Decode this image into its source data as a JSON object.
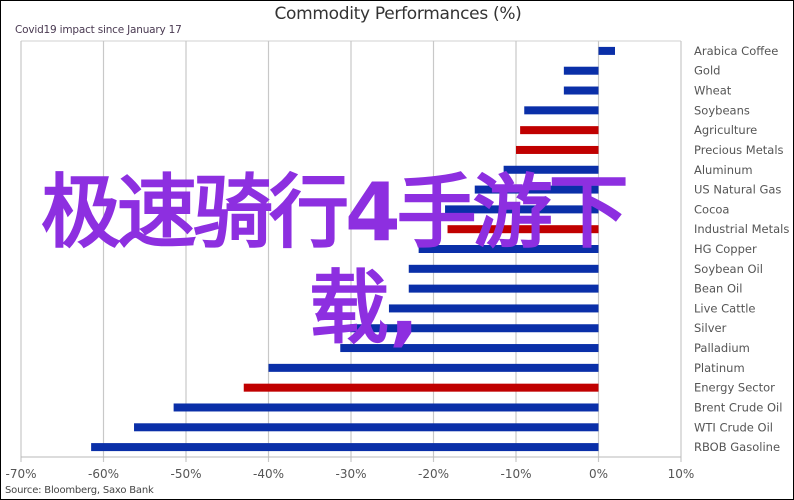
{
  "chart_data": {
    "type": "bar",
    "orientation": "horizontal",
    "title": "Commodity Performances (%)",
    "subtitle": "Covid19 impact since January 17",
    "source": "Source: Bloomberg, Saxo Bank",
    "xlabel": "",
    "ylabel": "",
    "xlim": [
      -70,
      10
    ],
    "x_ticks": [
      -70,
      -60,
      -50,
      -40,
      -30,
      -20,
      -10,
      0,
      10
    ],
    "x_tick_labels": [
      "-70%",
      "-60%",
      "-50%",
      "-40%",
      "-30%",
      "-20%",
      "-10%",
      "0%",
      "10%"
    ],
    "grid": "vertical",
    "legend": "none",
    "colors": {
      "commodity": "#0a2fa8",
      "sector": "#c00000"
    },
    "categories": [
      "Arabica Coffee",
      "Gold",
      "Wheat",
      "Soybeans",
      "Agriculture",
      "Precious Metals",
      "Aluminum",
      "US Natural Gas",
      "Cocoa",
      "Industrial Metals",
      "HG Copper",
      "Soybean Oil",
      "Bean Oil",
      "Live Cattle",
      "Silver",
      "Palladium",
      "Platinum",
      "Energy Sector",
      "Brent Crude Oil",
      "WTI Crude Oil",
      "RBOB Gasoline"
    ],
    "values": [
      2.0,
      -4.2,
      -4.2,
      -9.0,
      -9.5,
      -10.0,
      -11.5,
      -15.0,
      -18.6,
      -18.3,
      -21.8,
      -23.0,
      -23.0,
      -25.4,
      -30.1,
      -31.3,
      -40.0,
      -43.0,
      -51.5,
      -56.3,
      -61.5
    ],
    "bar_kind": [
      "commodity",
      "commodity",
      "commodity",
      "commodity",
      "sector",
      "sector",
      "commodity",
      "commodity",
      "commodity",
      "sector",
      "commodity",
      "commodity",
      "commodity",
      "commodity",
      "commodity",
      "commodity",
      "commodity",
      "sector",
      "commodity",
      "commodity",
      "commodity"
    ]
  },
  "watermark": {
    "line1": "极速骑行4手游下",
    "line2": "载,",
    "color": "#8d2fe0"
  }
}
